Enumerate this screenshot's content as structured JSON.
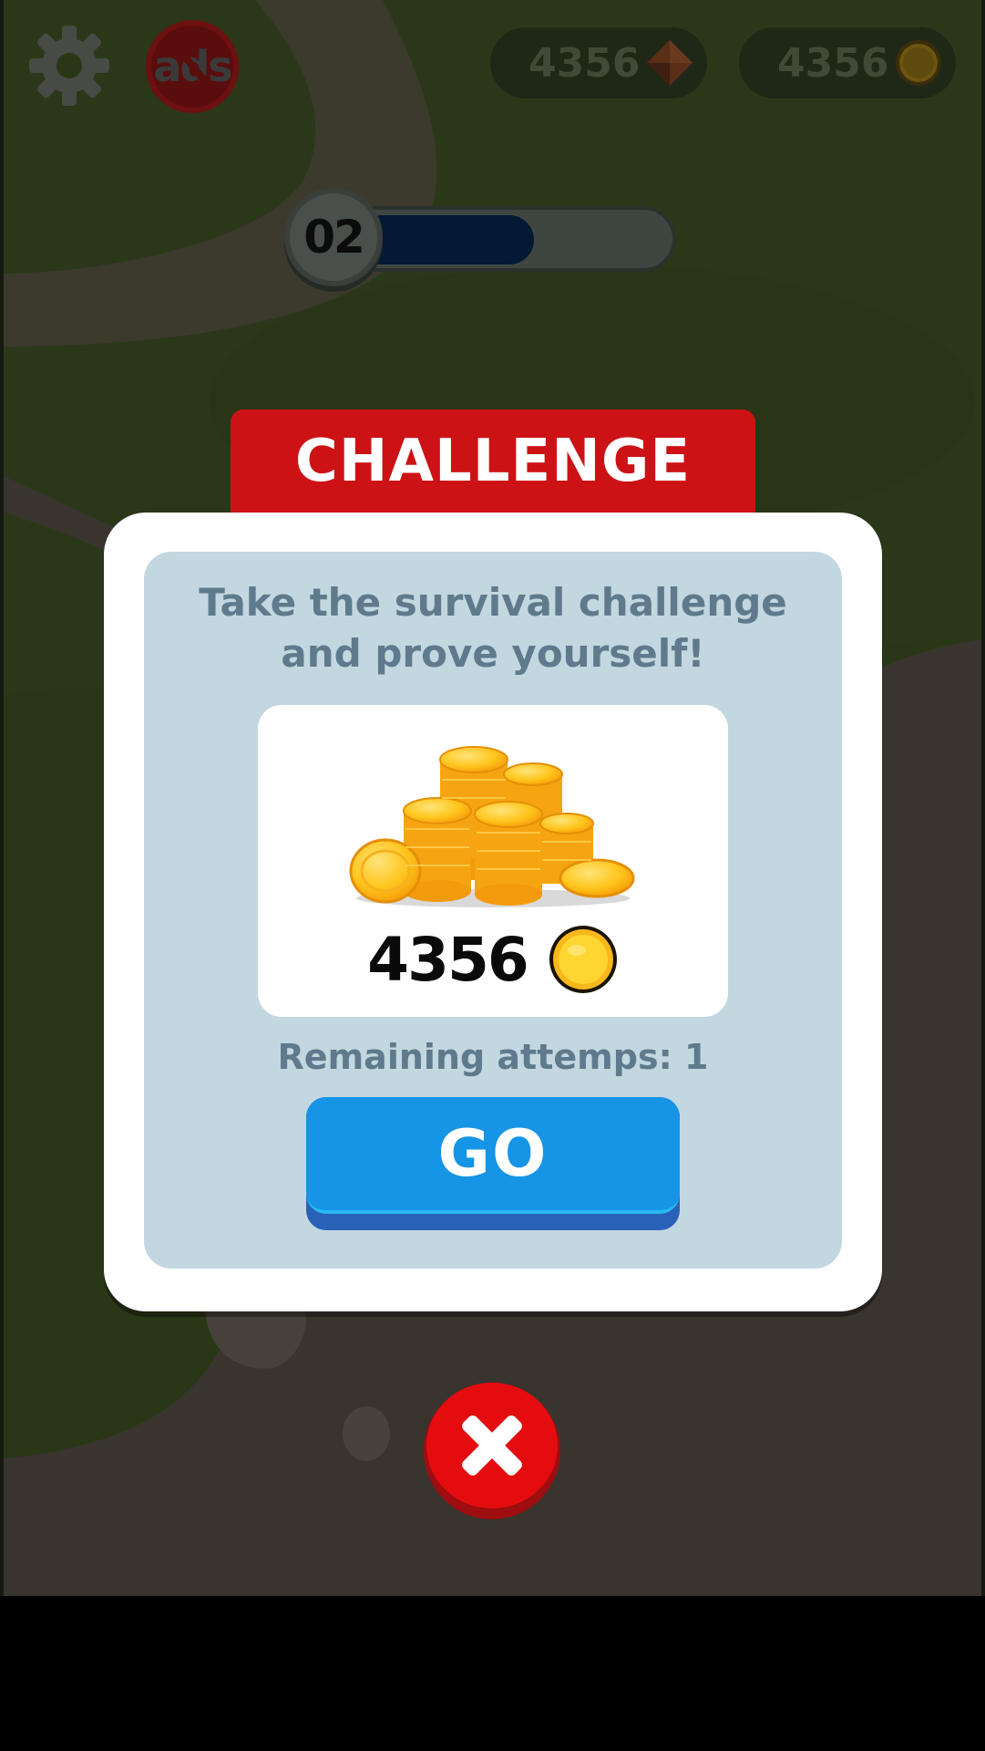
{
  "hud": {
    "settings_icon": "gear-icon",
    "noads_text": "ads",
    "gems": "4356",
    "coins": "4356"
  },
  "level": {
    "number": "02",
    "progress": 0.62
  },
  "modal": {
    "title": "CHALLENGE",
    "description_line1": "Take the survival challenge",
    "description_line2": "and prove yourself!",
    "reward_amount": "4356",
    "reward_icon": "coin-icon",
    "attempts_text": "Remaining attemps: 1",
    "go_label": "GO",
    "close_icon": "close-icon"
  },
  "colors": {
    "ribbon_red": "#cd1216",
    "go_blue": "#1694e6",
    "close_red": "#e50c10",
    "panel_blue": "#c3d7e0"
  }
}
